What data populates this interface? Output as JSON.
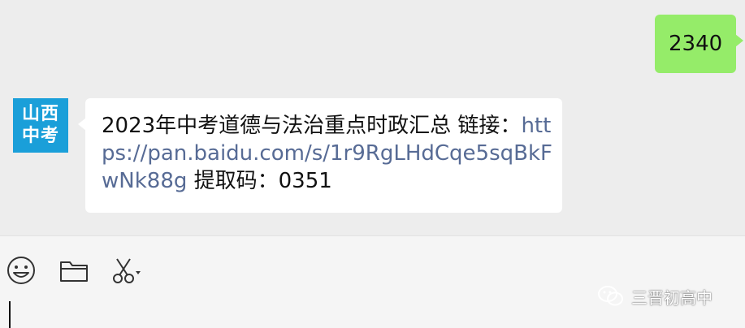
{
  "messages": {
    "outgoing_text": "2340",
    "avatar_lines": [
      "山西",
      "中考"
    ],
    "incoming_text": "2023年中考道德与法治重点时政汇总 链接：",
    "incoming_link": "https://pan.baidu.com/s/1r9RgLHdCqe5sqBkFwNk88g",
    "incoming_code_text": " 提取码：0351"
  },
  "toolbar": {
    "emoji_icon": "emoji-icon",
    "folder_icon": "folder-icon",
    "scissors_icon": "scissors-icon"
  },
  "watermark": {
    "text": "三晋初高中",
    "icon": "wechat-icon"
  },
  "colors": {
    "outgoing_bubble": "#95ec69",
    "incoming_bubble": "#ffffff",
    "link": "#576b95",
    "avatar_bg": "#1a9fd9",
    "chat_bg": "#ededed",
    "input_bg": "#f5f5f5"
  }
}
